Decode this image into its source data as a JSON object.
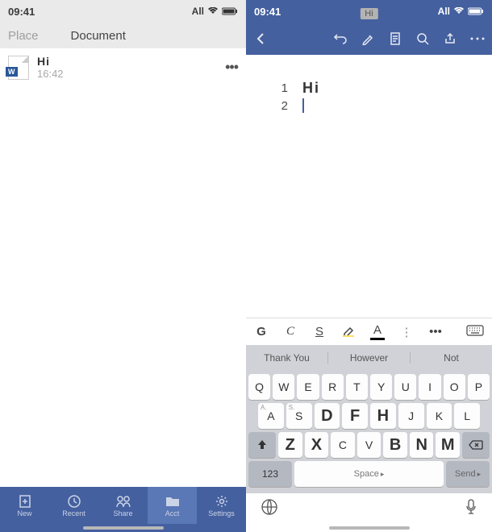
{
  "status": {
    "time": "09:41",
    "carrier": "All"
  },
  "left": {
    "tabs": [
      "Place",
      "Document"
    ],
    "file": {
      "name": "Hi",
      "time": "16:42"
    },
    "nav": [
      "New",
      "Recent",
      "Share",
      "Acct",
      "Settings"
    ]
  },
  "right": {
    "doc_tag": "Hi",
    "lines": [
      {
        "num": "1",
        "text": "Hi"
      },
      {
        "num": "2",
        "text": ""
      }
    ],
    "format": {
      "bold": "G",
      "italic": "C",
      "underline": "S",
      "fontcolor": "A"
    },
    "suggestions": [
      "Thank You",
      "However",
      "Not"
    ],
    "keyboard": {
      "row1": [
        "Q",
        "W",
        "E",
        "R",
        "T",
        "Y",
        "U",
        "I",
        "O",
        "P"
      ],
      "row2": [
        {
          "alt": "A.",
          "main": "A"
        },
        {
          "alt": "S.",
          "main": "S"
        },
        {
          "main": "D",
          "big": true
        },
        {
          "main": "F",
          "big": true
        },
        {
          "main": "H",
          "big": true
        },
        {
          "alt": "",
          "main": "J"
        },
        {
          "alt": "",
          "main": "K"
        },
        {
          "alt": "",
          "main": "L"
        }
      ],
      "row3": [
        "Z",
        "X",
        "C",
        "V",
        "B",
        "N",
        "M"
      ],
      "row3big": {
        "Z": true,
        "X": true,
        "B": true,
        "N": true,
        "M": true
      },
      "ctrl": {
        "num": "123",
        "space": "Space",
        "send": "Send"
      }
    }
  }
}
